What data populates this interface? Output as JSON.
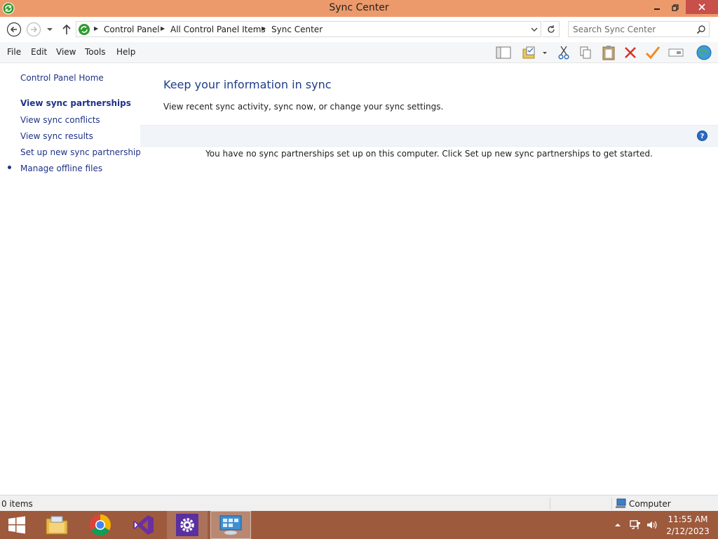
{
  "window": {
    "title": "Sync Center",
    "icon": "sync-center-icon"
  },
  "address": {
    "crumbs": [
      "Control Panel",
      "All Control Panel Items",
      "Sync Center"
    ],
    "search_placeholder": "Search Sync Center"
  },
  "menu": {
    "items": [
      "File",
      "Edit",
      "View",
      "Tools",
      "Help"
    ]
  },
  "toolbar": {
    "icons": [
      "layout-pane-icon",
      "properties-icon",
      "cut-icon",
      "copy-icon",
      "paste-icon",
      "delete-icon",
      "checkmark-icon",
      "rename-icon",
      "globe-icon"
    ]
  },
  "nav": {
    "home": "Control Panel Home",
    "links": [
      "View sync partnerships",
      "View sync conflicts",
      "View sync results",
      "Set up new sync partnerships",
      "Manage offline files"
    ],
    "current_index": 0
  },
  "main": {
    "heading": "Keep your information in sync",
    "description": "View recent sync activity, sync now, or change your sync settings.",
    "empty_message": "You have no sync partnerships set up on this computer. Click Set up new sync partnerships to get started."
  },
  "status": {
    "items": "0 items",
    "zone": "Computer"
  },
  "taskbar": {
    "apps": [
      "start-icon",
      "file-explorer-icon",
      "chrome-icon",
      "visual-studio-icon",
      "settings-icon",
      "control-panel-icon"
    ],
    "time": "11:55 AM",
    "date": "2/12/2023"
  },
  "colors": {
    "titlebar": "#ec9a6b",
    "taskbar": "#9e5a3c",
    "link": "#1e3287",
    "close": "#c7504a"
  }
}
